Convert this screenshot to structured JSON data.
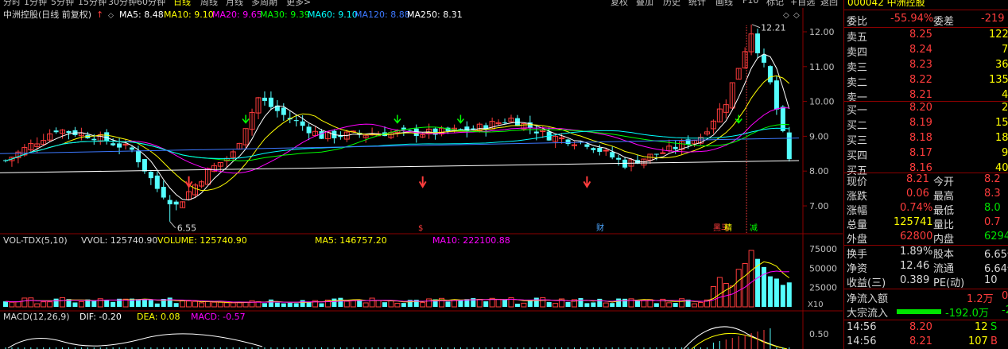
{
  "toolbar": {
    "periods": [
      "分时",
      "1分钟",
      "5分钟",
      "15分钟",
      "30分钟",
      "60分钟",
      "日线",
      "周线",
      "月线",
      "多周期",
      "更多>"
    ],
    "active_period": "日线",
    "buttons": [
      "复权",
      "叠加",
      "历史",
      "统计",
      "画线",
      "F10",
      "标记",
      "+自选",
      "返回"
    ]
  },
  "kline": {
    "title": "中洲控股(日线 前复权)",
    "ma_legend": [
      {
        "label": "MA5: 8.48",
        "color": "#ffffff"
      },
      {
        "label": "MA10: 9.10",
        "color": "#ffff00"
      },
      {
        "label": "MA20: 9.65",
        "color": "#ff00ff"
      },
      {
        "label": "MA30: 9.39",
        "color": "#00ff00"
      },
      {
        "label": "MA60: 9.10",
        "color": "#00ffff"
      },
      {
        "label": "MA120: 8.88",
        "color": "#3c78ff"
      },
      {
        "label": "MA250: 8.31",
        "color": "#ffffff"
      }
    ],
    "y_ticks": [
      "12.00",
      "11.00",
      "10.00",
      "9.00",
      "8.00",
      "7.00"
    ],
    "high_label": "12.21",
    "low_label": "6.55",
    "markers": [
      {
        "label": "$",
        "color": "#ff3c3c"
      },
      {
        "label": "财",
        "color": "#4da6ff"
      },
      {
        "label": "黑马",
        "color": "#ff3c3c"
      },
      {
        "label": "精",
        "color": "#ffff00"
      },
      {
        "label": "减",
        "color": "#00ff00"
      }
    ]
  },
  "volume": {
    "title": "VOL-TDX(5,10)",
    "vvol": "VVOL: 125740.90",
    "legend": [
      {
        "label": "VOLUME: 125740.90",
        "color": "#ffff00"
      },
      {
        "label": "MA5: 146757.20",
        "color": "#ffff00"
      },
      {
        "label": "MA10: 222100.88",
        "color": "#ff00ff"
      }
    ],
    "y_ticks": [
      "75000",
      "50000",
      "25000"
    ],
    "unit": "X10"
  },
  "macd": {
    "title": "MACD(12,26,9)",
    "legend": [
      {
        "label": "DIF: -0.20",
        "color": "#ffffff"
      },
      {
        "label": "DEA: 0.08",
        "color": "#ffff00"
      },
      {
        "label": "MACD: -0.57",
        "color": "#ff00ff"
      }
    ],
    "y_ticks": [
      "0.50"
    ]
  },
  "quote": {
    "code_name": "000042 中洲控股",
    "weibi": {
      "label": "委比",
      "value": "-55.94%",
      "label2": "委差",
      "value2": "-219"
    },
    "asks": [
      {
        "label": "卖五",
        "price": "8.25",
        "vol": "122"
      },
      {
        "label": "卖四",
        "price": "8.24",
        "vol": "7"
      },
      {
        "label": "卖三",
        "price": "8.23",
        "vol": "36"
      },
      {
        "label": "卖二",
        "price": "8.22",
        "vol": "135"
      },
      {
        "label": "卖一",
        "price": "8.21",
        "vol": "4"
      }
    ],
    "bids": [
      {
        "label": "买一",
        "price": "8.20",
        "vol": "2"
      },
      {
        "label": "买二",
        "price": "8.19",
        "vol": "15"
      },
      {
        "label": "买三",
        "price": "8.18",
        "vol": "18"
      },
      {
        "label": "买四",
        "price": "8.17",
        "vol": "9"
      },
      {
        "label": "买五",
        "price": "8.16",
        "vol": "40"
      }
    ],
    "stats": [
      {
        "l1": "现价",
        "v1": "8.21",
        "c1": "red",
        "l2": "今开",
        "v2": "8.2",
        "c2": "red"
      },
      {
        "l1": "涨跌",
        "v1": "0.06",
        "c1": "red",
        "l2": "最高",
        "v2": "8.3",
        "c2": "red"
      },
      {
        "l1": "涨幅",
        "v1": "0.74%",
        "c1": "red",
        "l2": "最低",
        "v2": "8.0",
        "c2": "green"
      },
      {
        "l1": "总量",
        "v1": "125741",
        "c1": "yellow",
        "l2": "量比",
        "v2": "0.7",
        "c2": "red"
      },
      {
        "l1": "外盘",
        "v1": "62800",
        "c1": "red",
        "l2": "内盘",
        "v2": "6294",
        "c2": "green"
      }
    ],
    "stats2": [
      {
        "l1": "换手",
        "v1": "1.89%",
        "c1": "white",
        "l2": "股本",
        "v2": "6.65亿",
        "c2": "white"
      },
      {
        "l1": "净资",
        "v1": "12.46",
        "c1": "white",
        "l2": "流通",
        "v2": "6.64亿",
        "c2": "white"
      },
      {
        "l1": "收益(三)",
        "v1": "0.389",
        "c1": "white",
        "l2": "PE(动)",
        "v2": "10",
        "c2": "white"
      }
    ],
    "flow": [
      {
        "label": "净流入额",
        "value": "1.2万",
        "extra": "0",
        "color": "red"
      },
      {
        "label": "大宗流入",
        "value": "-192.0万",
        "extra": "-2",
        "color": "green"
      }
    ],
    "ticks": [
      {
        "time": "14:56",
        "price": "8.20",
        "vol": "12",
        "side": "S"
      },
      {
        "time": "14:56",
        "price": "8.21",
        "vol": "107",
        "side": "B"
      }
    ]
  }
}
